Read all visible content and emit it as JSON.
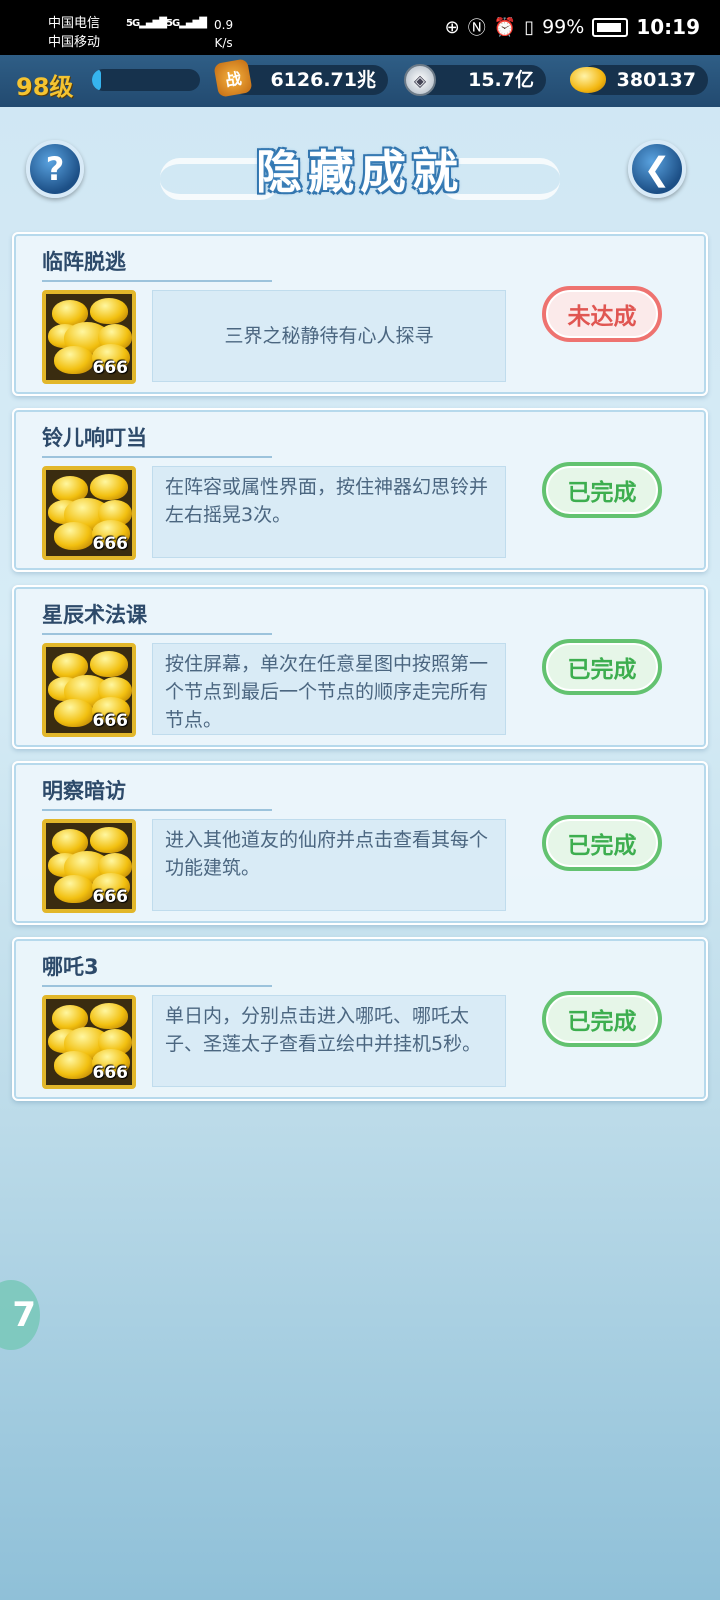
{
  "status_bar": {
    "carrier1": "中国电信",
    "carrier2": "中国移动",
    "sig1": "5G",
    "sig2": "5G",
    "speed_value": "0.9",
    "speed_unit": "K/s",
    "battery": "99%",
    "time": "10:19"
  },
  "resources": {
    "level": "98级",
    "level_progress": 0.08,
    "power_icon_text": "战",
    "power": "6126.71兆",
    "coins": "15.7亿",
    "gold": "380137"
  },
  "header": {
    "title": "隐藏成就",
    "help_label": "?",
    "back_label": "❮"
  },
  "achievements": [
    {
      "title": "临阵脱逃",
      "count": "666",
      "desc": "三界之秘静待有心人探寻",
      "status": "未达成",
      "done": false
    },
    {
      "title": "铃儿响叮当",
      "count": "666",
      "desc": "在阵容或属性界面，按住神器幻思铃并左右摇晃3次。",
      "status": "已完成",
      "done": true
    },
    {
      "title": "星辰术法课",
      "count": "666",
      "desc": "按住屏幕，单次在任意星图中按照第一个节点到最后一个节点的顺序走完所有节点。",
      "status": "已完成",
      "done": true
    },
    {
      "title": "明察暗访",
      "count": "666",
      "desc": "进入其他道友的仙府并点击查看其每个功能建筑。",
      "status": "已完成",
      "done": true
    },
    {
      "title": "哪吒3",
      "count": "666",
      "desc": "单日内，分别点击进入哪吒、哪吒太子、圣莲太子查看立绘中并挂机5秒。",
      "status": "已完成",
      "done": true
    }
  ],
  "floating_button": "7"
}
